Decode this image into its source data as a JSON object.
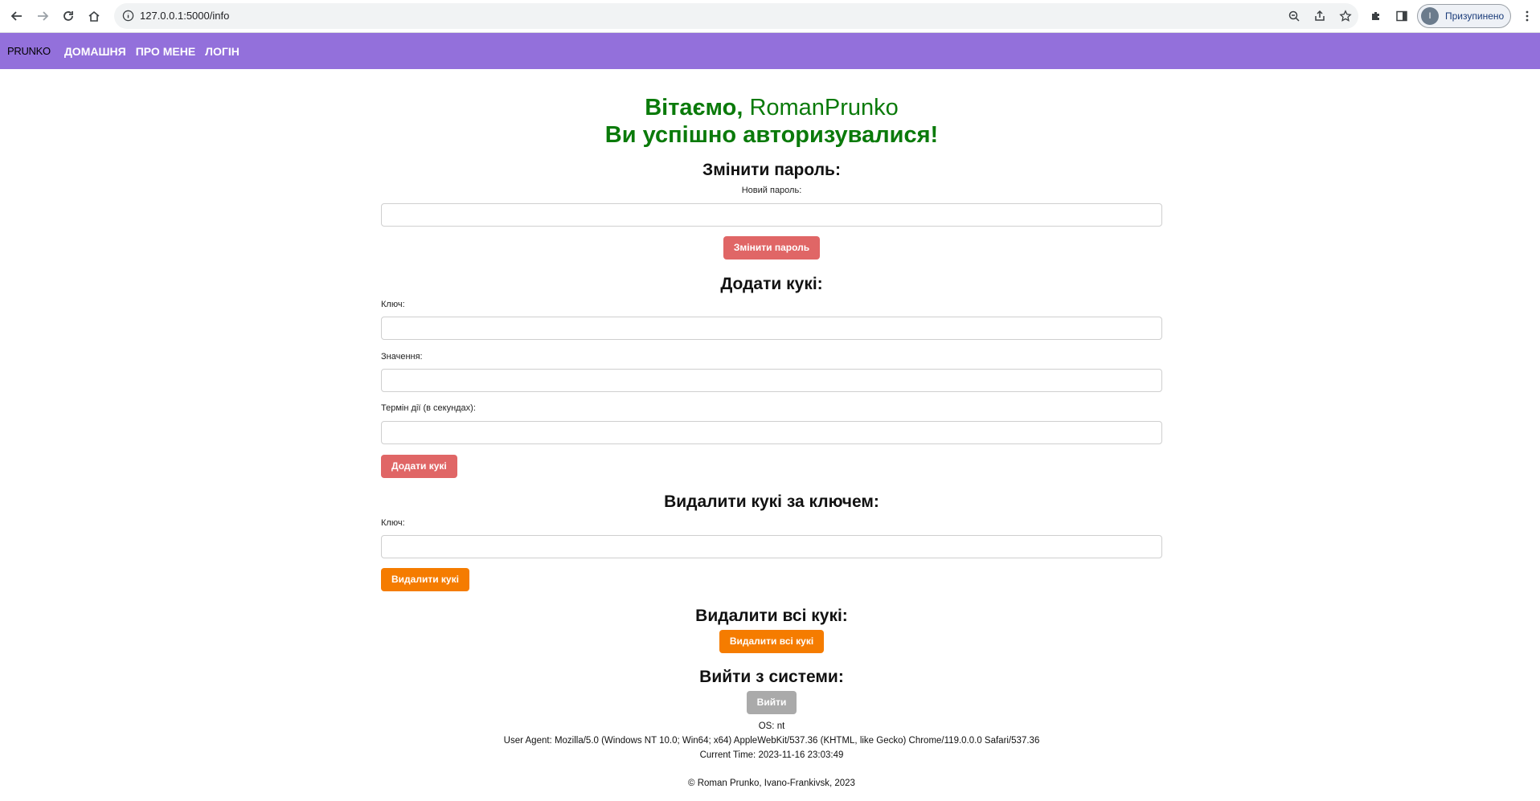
{
  "browser": {
    "url": "127.0.0.1:5000/info",
    "profile_initial": "I",
    "profile_status": "Призупинено",
    "icons": [
      "back-arrow-icon",
      "forward-arrow-icon",
      "reload-icon",
      "home-icon",
      "site-info-icon",
      "zoom-icon",
      "share-icon",
      "bookmark-star-icon",
      "extensions-icon",
      "side-panel-icon",
      "menu-dots-icon"
    ]
  },
  "nav": {
    "brand": "PRUNKO",
    "links": [
      "ДОМАШНЯ",
      "ПРО МЕНЕ",
      "ЛОГІН"
    ],
    "color": "#9370db"
  },
  "welcome": {
    "greeting": "Вітаємо, ",
    "username": "RomanPrunko",
    "success": "Ви успішно авторизувалися!",
    "color": "#0a7a0a"
  },
  "change_password": {
    "heading": "Змінити пароль:",
    "label": "Новий пароль:",
    "button": "Змінити пароль"
  },
  "add_cookie": {
    "heading": "Додати кукі:",
    "key_label": "Ключ:",
    "value_label": "Значення:",
    "expiry_label": "Термін дії (в секундах):",
    "button": "Додати кукі"
  },
  "delete_cookie": {
    "heading": "Видалити кукі за ключем:",
    "key_label": "Ключ:",
    "button": "Видалити кукі"
  },
  "delete_all": {
    "heading": "Видалити всі кукі:",
    "button": "Видалити всі кукі"
  },
  "logout": {
    "heading": "Вийти з системи:",
    "button": "Вийти"
  },
  "system_info": {
    "os": "OS: nt",
    "user_agent": "User Agent: Mozilla/5.0 (Windows NT 10.0; Win64; x64) AppleWebKit/537.36 (KHTML, like Gecko) Chrome/119.0.0.0 Safari/537.36",
    "current_time": "Current Time: 2023-11-16 23:03:49"
  },
  "footer": "© Roman Prunko, Ivano-Frankivsk, 2023",
  "colors": {
    "red_button": "#e06666",
    "orange_button": "#f57c00",
    "gray_button": "#aaaaaa"
  }
}
